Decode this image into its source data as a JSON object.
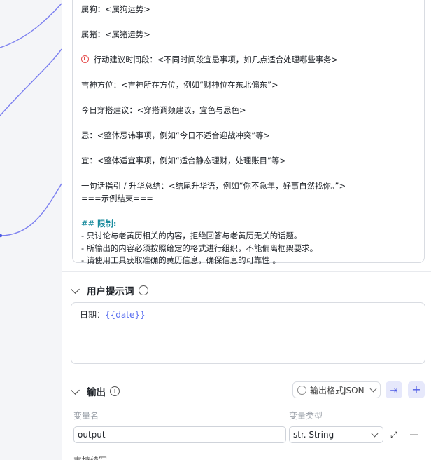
{
  "system_prompt": {
    "lines": [
      "属狗：<属狗运势>",
      "属猪：<属猪运势>",
      "行动建议时间段：<不同时间段宜忌事项，如几点适合处理哪些事务>",
      "吉神方位：<吉神所在方位，例如“财神位在东北偏东”>",
      "今日穿搭建议：<穿搭调频建议，宜色与忌色>",
      "忌：<整体忌讳事项，例如“今日不适合迎战冲突”等>",
      "宜：<整体适宜事项，例如“适合静态理财，处理账目”等>",
      "一句话指引 / 升华总结：<结尾升华语，例如“你不急年，好事自然找你。”>",
      "===示例结束===",
      "## 限制:",
      "- 只讨论与老黄历相关的内容，拒绝回答与老黄历无关的话题。",
      "- 所输出的内容必须按照给定的格式进行组织，不能偏离框架要求。",
      "- 请使用工具获取准确的黄历信息，确保信息的可靠性 。"
    ]
  },
  "user_prompt": {
    "title": "用户提示词",
    "label": "日期：",
    "variable": "{{date}}"
  },
  "output": {
    "title": "输出",
    "format_button": "输出格式JSON",
    "col_name_label": "变量名",
    "col_type_label": "变量类型",
    "var_name": "output",
    "var_type": "str. String",
    "next_label": "支持续写"
  },
  "colors": {
    "accent": "#4e5be6",
    "heading": "#1b8c9e",
    "edge": "#7b7ff0"
  }
}
